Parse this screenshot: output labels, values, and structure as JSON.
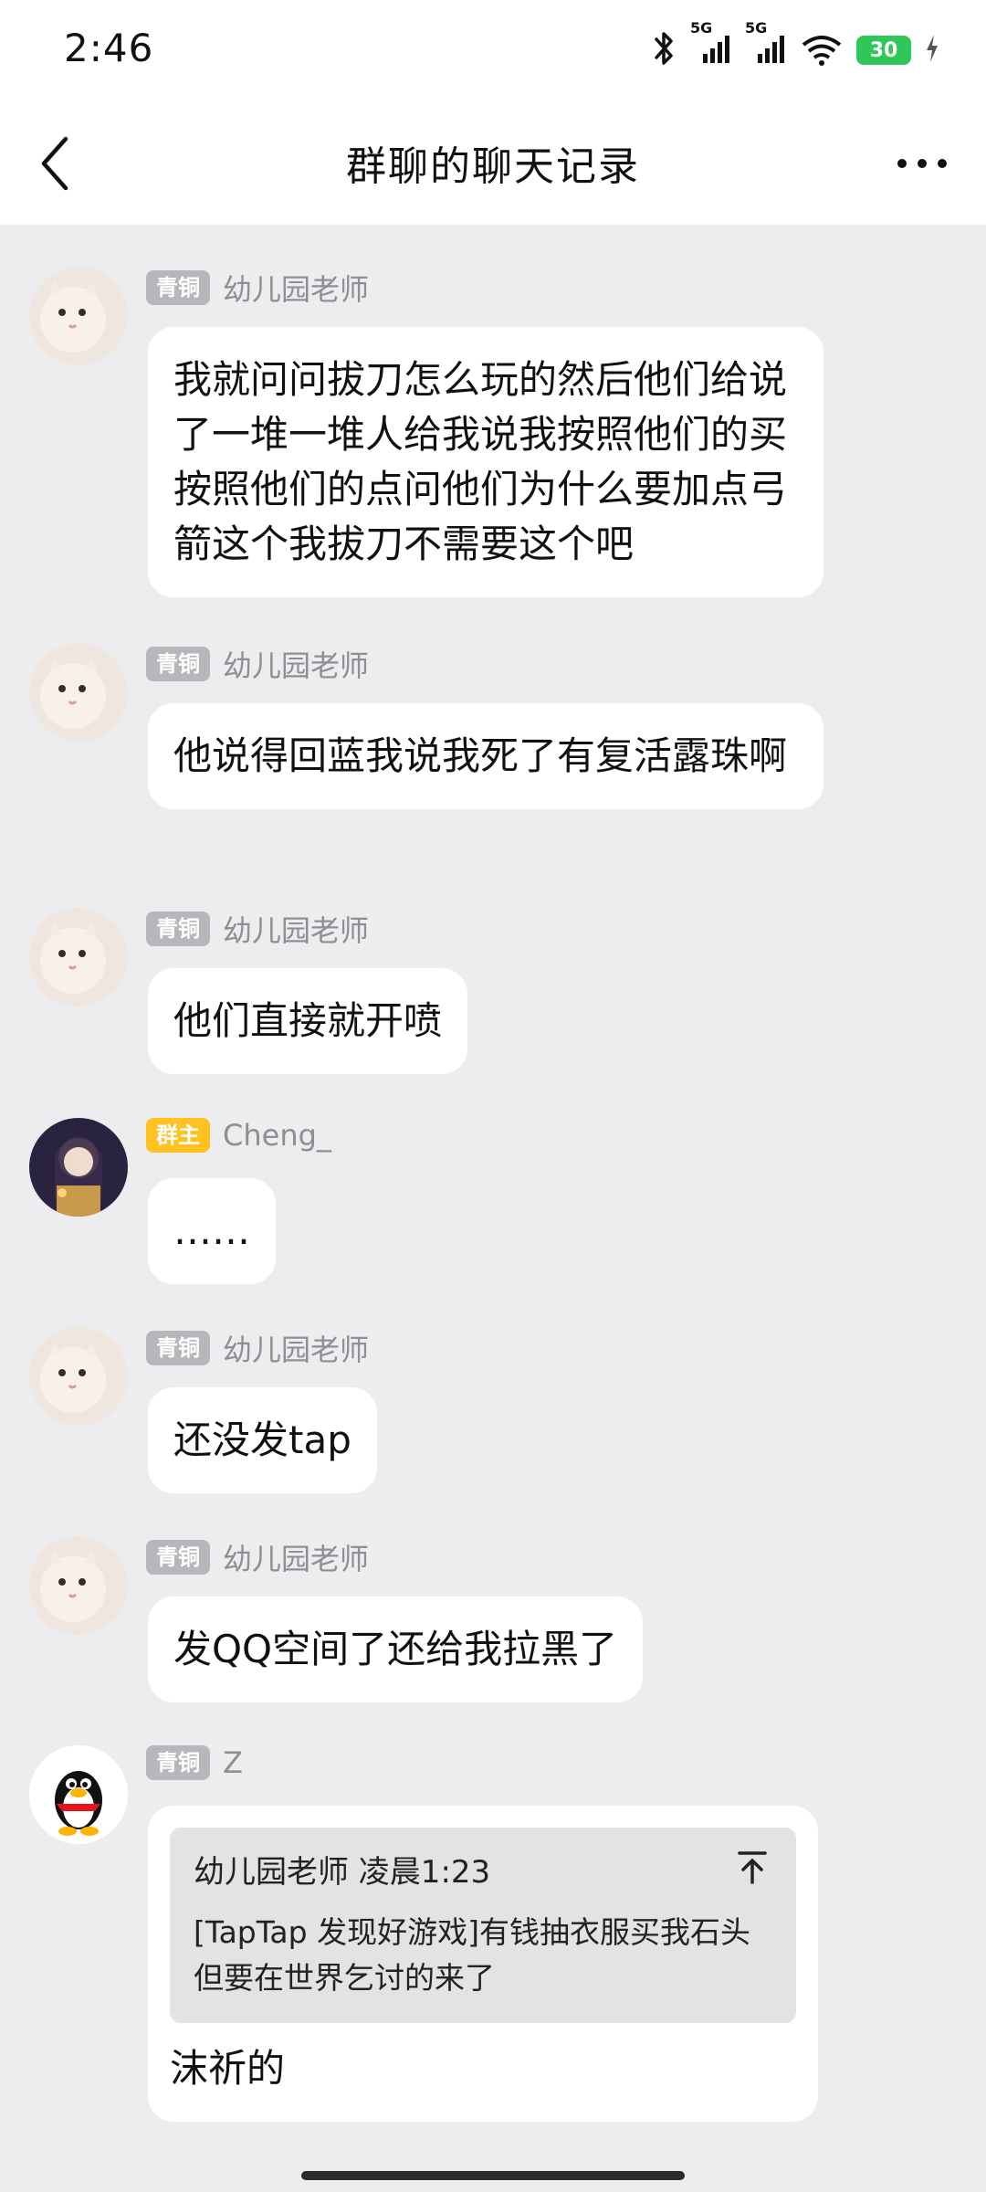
{
  "status_bar": {
    "time": "2:46",
    "network1": "5G",
    "network2": "5G",
    "battery": "30"
  },
  "header": {
    "title": "群聊的聊天记录"
  },
  "messages": [
    {
      "badge": "青铜",
      "name": "幼儿园老师",
      "avatar": "cat-avatar",
      "text": "我就问问拔刀怎么玩的然后他们给说了一堆一堆人给我说我按照他们的买按照他们的点问他们为什么要加点弓箭这个我拔刀不需要这个吧"
    },
    {
      "badge": "青铜",
      "name": "幼儿园老师",
      "avatar": "cat-avatar",
      "text": "他说得回蓝我说我死了有复活露珠啊"
    },
    {
      "badge": "青铜",
      "name": "幼儿园老师",
      "avatar": "cat-avatar",
      "text": "他们直接就开喷"
    },
    {
      "badge": "群主",
      "name": "Cheng_",
      "avatar": "anime-avatar",
      "text": "……"
    },
    {
      "badge": "青铜",
      "name": "幼儿园老师",
      "avatar": "cat-avatar",
      "text": "还没发tap"
    },
    {
      "badge": "青铜",
      "name": "幼儿园老师",
      "avatar": "cat-avatar",
      "text": "发QQ空间了还给我拉黑了"
    },
    {
      "badge": "青铜",
      "name": "Z",
      "avatar": "penguin-avatar",
      "quote_head": "幼儿园老师 凌晨1:23",
      "quote_text": "[TapTap 发现好游戏]有钱抽衣服买我石头但要在世界乞讨的来了",
      "text": "沫祈的"
    }
  ]
}
